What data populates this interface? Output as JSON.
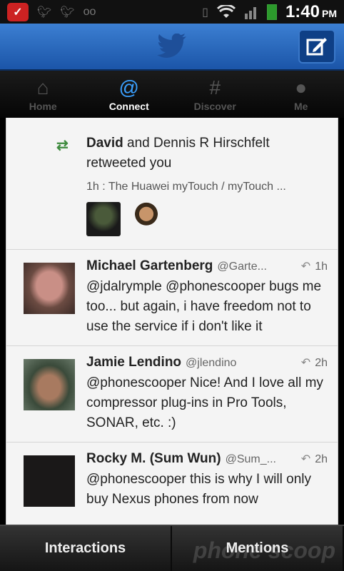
{
  "status": {
    "time": "1:40",
    "ampm": "PM",
    "left_icons": [
      "app-notification-icon",
      "twitter-icon",
      "twitter-icon",
      "voicemail-icon"
    ],
    "right_icons": [
      "vibrate-icon",
      "wifi-icon",
      "signal-icon",
      "battery-icon"
    ]
  },
  "tabs": [
    {
      "label": "Home",
      "icon": "home-icon"
    },
    {
      "label": "Connect",
      "icon": "at-icon"
    },
    {
      "label": "Discover",
      "icon": "hash-icon"
    },
    {
      "label": "Me",
      "icon": "person-icon"
    }
  ],
  "retweet": {
    "name": "David",
    "rest": " and Dennis R Hirschfelt retweeted you",
    "time": "1h",
    "snippet": "The Huawei myTouch / myTouch ..."
  },
  "tweets": [
    {
      "name": "Michael Gartenberg",
      "handle": "@Garte...",
      "time": "1h",
      "text": "@jdalrymple @phonescooper bugs me too... but again, i have freedom not to use the service if i don't like it"
    },
    {
      "name": "Jamie Lendino",
      "handle": "@jlendino",
      "time": "2h",
      "text": "@phonescooper Nice! And I love all my compressor plug-ins in Pro Tools, SONAR, etc. :)"
    },
    {
      "name": "Rocky M. (Sum Wun)",
      "handle": "@Sum_...",
      "time": "2h",
      "text": "@phonescooper this is why I will only buy Nexus phones from now"
    }
  ],
  "bottom": {
    "interactions": "Interactions",
    "mentions": "Mentions"
  },
  "watermark": "phone scoop",
  "colors": {
    "accent": "#3aa0ff",
    "title_bar": "#2a6ac0",
    "retweet_green": "#3f8b3f"
  }
}
